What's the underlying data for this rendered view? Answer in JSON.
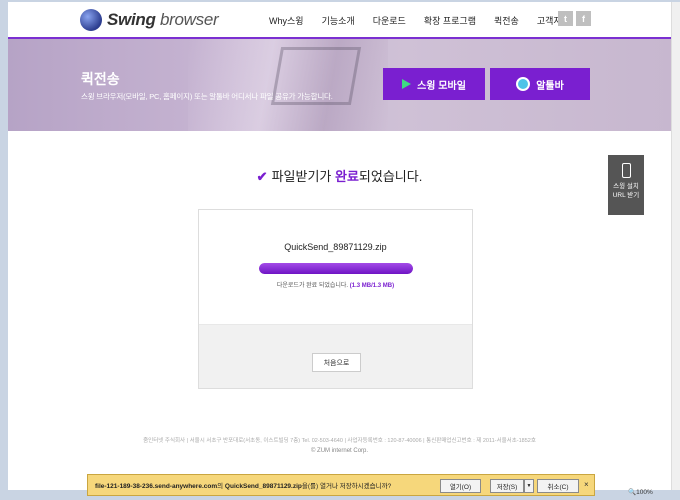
{
  "header": {
    "logo_bold": "Swing",
    "logo_rest": " browser",
    "nav": [
      "Why스윙",
      "기능소개",
      "다운로드",
      "확장 프로그램",
      "퀵전송",
      "고객지원"
    ],
    "social": [
      "t",
      "f"
    ]
  },
  "hero": {
    "title": "퀵전송",
    "subtitle": "스윙 브라우저(모바일, PC, 홈페이지) 또는 알툴바 어디서나 파일 공유가 가능합니다.",
    "btn_mobile": "스윙 모바일",
    "btn_toolbar": "알툴바",
    "colors": {
      "accent": "#7a1fd0"
    }
  },
  "side_tab": {
    "line1": "스윙 설치",
    "line2": "URL 받기"
  },
  "main": {
    "done_pre": "파일받기가 ",
    "done_hl": "완료",
    "done_post": "되었습니다.",
    "filename": "QuickSend_89871129.zip",
    "progress_fraction": 1.0,
    "status_text": "다운로드가 완료 되었습니다.",
    "status_size": "(1.3 MB/1.3 MB)",
    "restart_label": "처음으로"
  },
  "footer": {
    "line": "줌인터넷 주식회사 | 서울시 서초구 반포대로(서초동, 이스트빌딩 7층) Tel. 02-503-4640 | 사업자등록번호 : 120-87-40006 | 통신판매업신고번호 : 제 2011-서울서초-1852호",
    "copy": "© ZUM internet Corp."
  },
  "download_bar": {
    "host": "file-121-189-38-236.send-anywhere.com",
    "mid": "의 ",
    "file": "QuickSend_89871129.zip",
    "tail": "을(를) 열거나 저장하시겠습니까?",
    "open": "열기(O)",
    "save": "저장(S)",
    "cancel": "취소(C)",
    "close": "×"
  },
  "zoom": "100%"
}
